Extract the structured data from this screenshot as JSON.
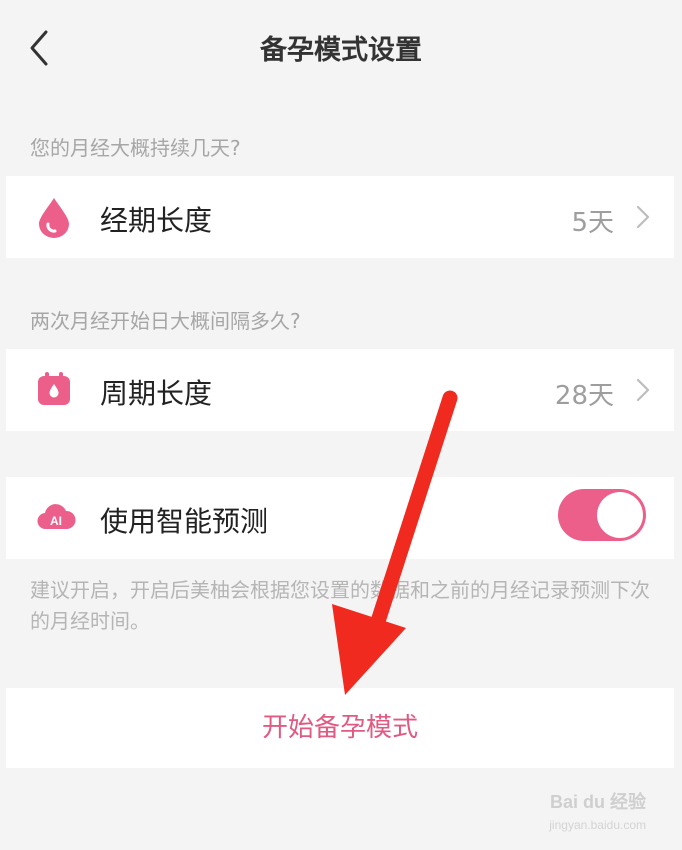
{
  "header": {
    "title": "备孕模式设置"
  },
  "period_section": {
    "question": "您的月经大概持续几天?",
    "label": "经期长度",
    "value": "5天"
  },
  "cycle_section": {
    "question": "两次月经开始日大概间隔多久?",
    "label": "周期长度",
    "value": "28天"
  },
  "ai_section": {
    "icon_text": "AI",
    "label": "使用智能预测",
    "toggle_on": true,
    "note": "建议开启，开启后美柚会根据您设置的数据和之前的月经记录预测下次的月经时间。"
  },
  "start_button": {
    "label": "开始备孕模式"
  },
  "watermark": {
    "text": "Bai du 经验",
    "url": "jingyan.baidu.com"
  },
  "colors": {
    "accent": "#ec5f8a",
    "arrow": "#f02a1e"
  }
}
